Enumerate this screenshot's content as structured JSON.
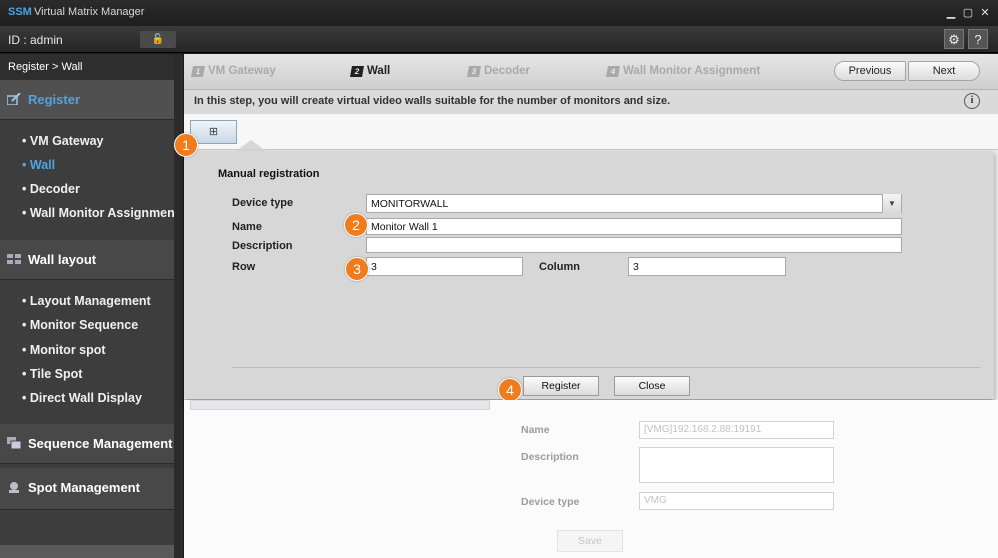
{
  "app": {
    "brand": "SSM",
    "title": "Virtual Matrix Manager"
  },
  "idbar": {
    "user": "ID : admin"
  },
  "sidebar": {
    "breadcrumb": "Register > Wall",
    "sections": [
      {
        "label": "Register",
        "items": [
          "VM Gateway",
          "Wall",
          "Decoder",
          "Wall Monitor Assignment"
        ]
      },
      {
        "label": "Wall layout",
        "items": [
          "Layout Management",
          "Monitor Sequence",
          "Monitor spot",
          "Tile Spot",
          "Direct Wall Display"
        ]
      },
      {
        "label": "Sequence Management"
      },
      {
        "label": "Spot Management"
      }
    ],
    "active_item": "Wall"
  },
  "steps": [
    {
      "num": "1",
      "label": "VM Gateway"
    },
    {
      "num": "2",
      "label": "Wall"
    },
    {
      "num": "3",
      "label": "Decoder"
    },
    {
      "num": "4",
      "label": "Wall Monitor Assignment"
    }
  ],
  "nav": {
    "previous": "Previous",
    "next": "Next"
  },
  "info": {
    "text": "In this step, you will create virtual video walls suitable for the number of monitors and size.",
    "icon": "i"
  },
  "dialog": {
    "title": "Manual registration",
    "device_type_label": "Device type",
    "device_type_value": "MONITORWALL",
    "name_label": "Name",
    "name_value": "Monitor Wall 1",
    "description_label": "Description",
    "description_value": "",
    "row_label": "Row",
    "row_value": "3",
    "column_label": "Column",
    "column_value": "3",
    "register": "Register",
    "close": "Close"
  },
  "badges": [
    "1",
    "2",
    "3",
    "4"
  ],
  "bgform": {
    "name_label": "Name",
    "name_value": "[VMG]192.168.2.88:19191",
    "description_label": "Description",
    "device_type_label": "Device type",
    "device_type_value": "VMG",
    "save": "Save"
  },
  "colors": {
    "accent": "#4fa3e0",
    "badge": "#f07c1d"
  }
}
